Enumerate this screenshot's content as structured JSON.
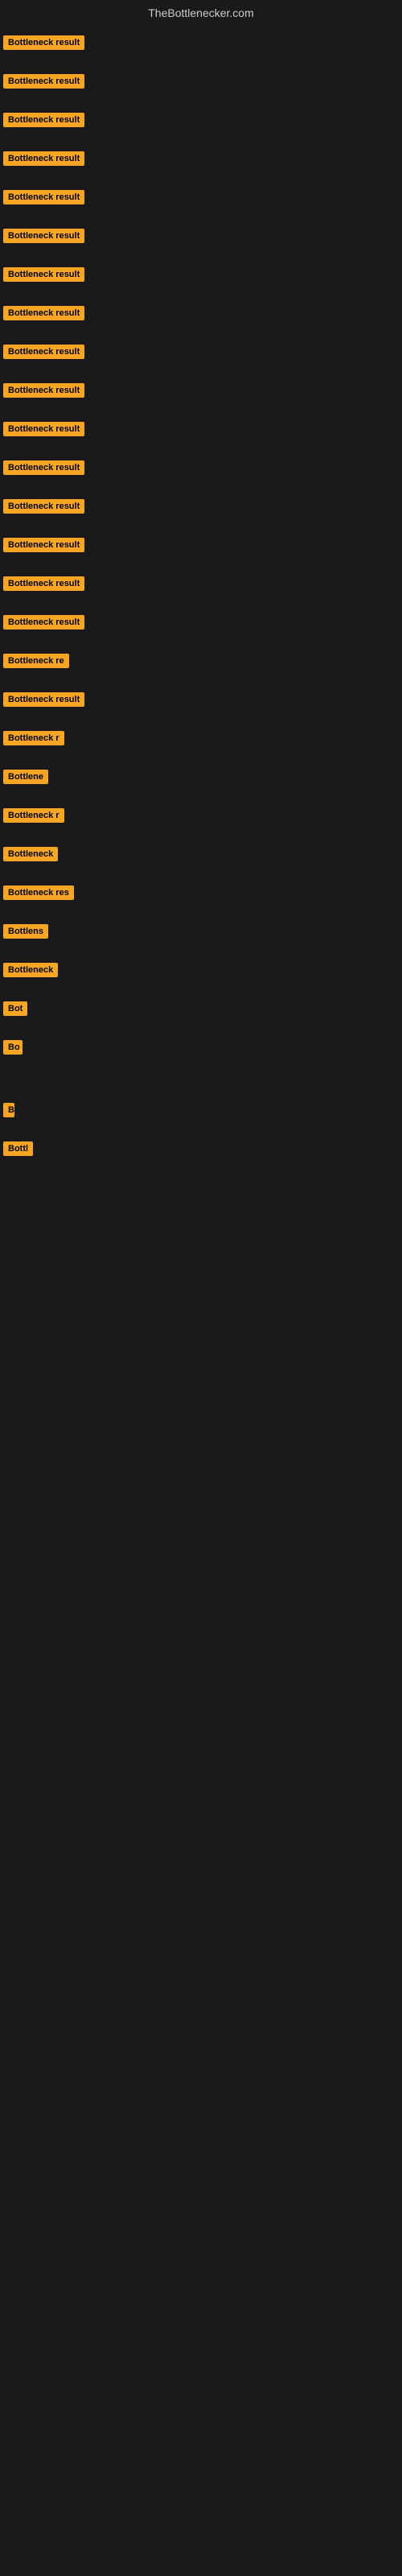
{
  "header": {
    "title": "TheBottlenecker.com"
  },
  "items": [
    {
      "label": "Bottleneck result",
      "width": 120
    },
    {
      "label": "Bottleneck result",
      "width": 120
    },
    {
      "label": "Bottleneck result",
      "width": 120
    },
    {
      "label": "Bottleneck result",
      "width": 120
    },
    {
      "label": "Bottleneck result",
      "width": 120
    },
    {
      "label": "Bottleneck result",
      "width": 120
    },
    {
      "label": "Bottleneck result",
      "width": 120
    },
    {
      "label": "Bottleneck result",
      "width": 120
    },
    {
      "label": "Bottleneck result",
      "width": 120
    },
    {
      "label": "Bottleneck result",
      "width": 120
    },
    {
      "label": "Bottleneck result",
      "width": 120
    },
    {
      "label": "Bottleneck result",
      "width": 120
    },
    {
      "label": "Bottleneck result",
      "width": 120
    },
    {
      "label": "Bottleneck result",
      "width": 120
    },
    {
      "label": "Bottleneck result",
      "width": 120
    },
    {
      "label": "Bottleneck result",
      "width": 120
    },
    {
      "label": "Bottleneck re",
      "width": 95
    },
    {
      "label": "Bottleneck result",
      "width": 110
    },
    {
      "label": "Bottleneck r",
      "width": 88
    },
    {
      "label": "Bottlene",
      "width": 68
    },
    {
      "label": "Bottleneck r",
      "width": 88
    },
    {
      "label": "Bottleneck",
      "width": 78
    },
    {
      "label": "Bottleneck res",
      "width": 98
    },
    {
      "label": "Bottlens",
      "width": 65
    },
    {
      "label": "Bottleneck",
      "width": 78
    },
    {
      "label": "Bot",
      "width": 32
    },
    {
      "label": "Bo",
      "width": 24
    },
    {
      "label": "",
      "width": 0
    },
    {
      "label": "B",
      "width": 14
    },
    {
      "label": "Bottl",
      "width": 40
    }
  ]
}
